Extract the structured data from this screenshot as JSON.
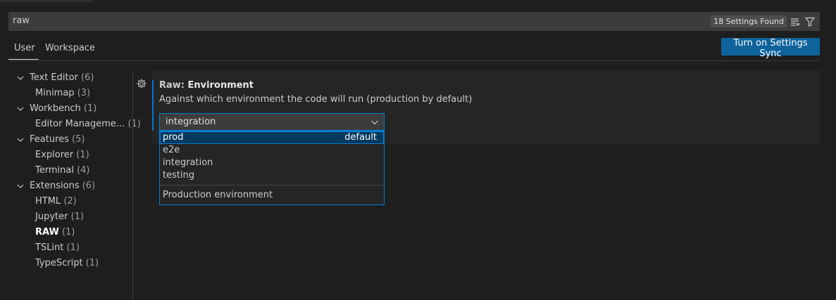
{
  "search": {
    "value": "raw",
    "result_count": "18 Settings Found",
    "clear_icon": "clear-all-icon",
    "filter_icon": "filter-icon"
  },
  "tabs": [
    {
      "label": "User",
      "active": true
    },
    {
      "label": "Workspace",
      "active": false
    }
  ],
  "sync_button": {
    "label": "Turn on Settings Sync"
  },
  "toc": {
    "items": [
      {
        "label": "Text Editor",
        "count": "(6)",
        "level": 0,
        "expanded": true
      },
      {
        "label": "Minimap",
        "count": "(3)",
        "level": 1
      },
      {
        "label": "Workbench",
        "count": "(1)",
        "level": 0,
        "expanded": true
      },
      {
        "label": "Editor Manageme...",
        "count": "(1)",
        "level": 1
      },
      {
        "label": "Features",
        "count": "(5)",
        "level": 0,
        "expanded": true
      },
      {
        "label": "Explorer",
        "count": "(1)",
        "level": 1
      },
      {
        "label": "Terminal",
        "count": "(4)",
        "level": 1
      },
      {
        "label": "Extensions",
        "count": "(6)",
        "level": 0,
        "expanded": true
      },
      {
        "label": "HTML",
        "count": "(2)",
        "level": 1
      },
      {
        "label": "Jupyter",
        "count": "(1)",
        "level": 1
      },
      {
        "label": "RAW",
        "count": "(1)",
        "level": 1,
        "selected": true
      },
      {
        "label": "TSLint",
        "count": "(1)",
        "level": 1
      },
      {
        "label": "TypeScript",
        "count": "(1)",
        "level": 1
      }
    ]
  },
  "setting": {
    "category": "Raw: ",
    "name": "Environment",
    "description": "Against which environment the code will run (production by default)",
    "value": "integration",
    "options": [
      {
        "label": "prod",
        "default_label": "default",
        "highlighted": true
      },
      {
        "label": "e2e"
      },
      {
        "label": "integration"
      },
      {
        "label": "testing"
      }
    ],
    "option_description": "Production environment"
  },
  "colors": {
    "accent": "#007acc",
    "button": "#0e639c",
    "background": "#1e1e1e"
  }
}
